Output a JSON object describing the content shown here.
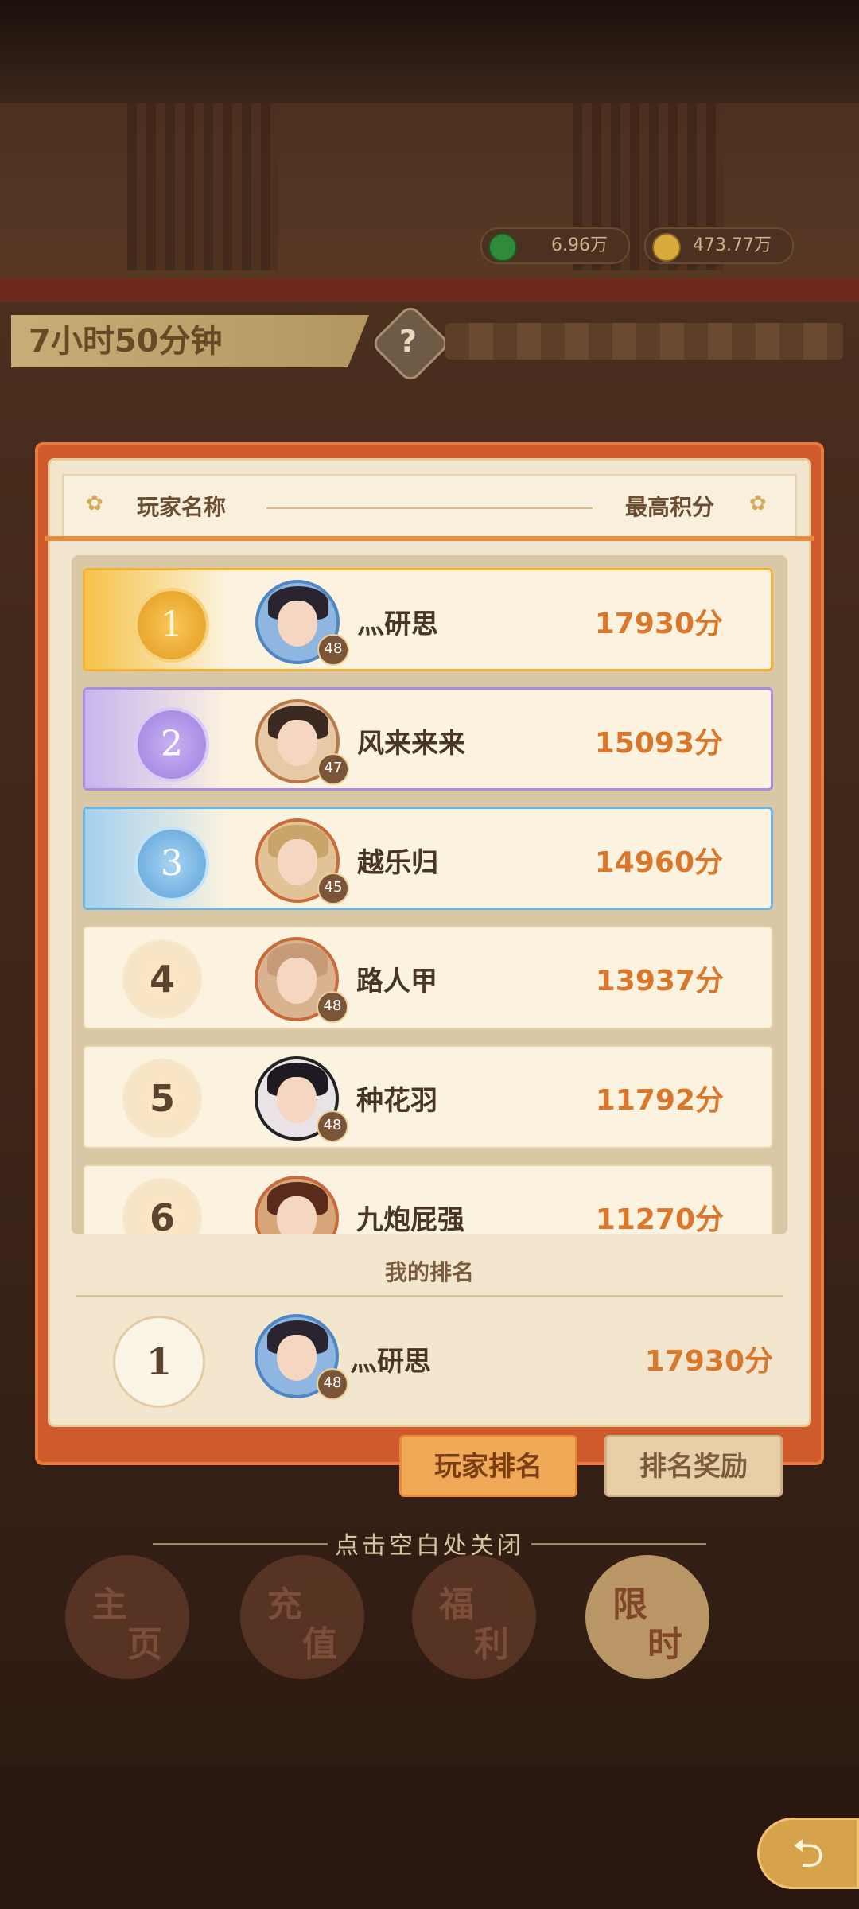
{
  "currency": {
    "jade": "6.96万",
    "coins": "473.77万"
  },
  "timer": {
    "text": "7小时50分钟",
    "help": "?"
  },
  "table_header": {
    "name_col": "玩家名称",
    "score_col": "最高积分"
  },
  "ranking": [
    {
      "rank": "1",
      "name": "灬研思",
      "level": "48",
      "score": "17930分"
    },
    {
      "rank": "2",
      "name": "风来来来",
      "level": "47",
      "score": "15093分"
    },
    {
      "rank": "3",
      "name": "越乐归",
      "level": "45",
      "score": "14960分"
    },
    {
      "rank": "4",
      "name": "路人甲",
      "level": "48",
      "score": "13937分"
    },
    {
      "rank": "5",
      "name": "种花羽",
      "level": "48",
      "score": "11792分"
    },
    {
      "rank": "6",
      "name": "九炮屁强",
      "level": "",
      "score": "11270分"
    }
  ],
  "my_rank": {
    "label": "我的排名",
    "rank": "1",
    "name": "灬研思",
    "level": "48",
    "score": "17930分"
  },
  "tabs": {
    "player_rank": "玩家排名",
    "rank_reward": "排名奖励"
  },
  "close_hint": "点击空白处关闭",
  "nav": {
    "home": [
      "主",
      "页"
    ],
    "recharge": [
      "充",
      "值"
    ],
    "welfare": [
      "福",
      "利"
    ],
    "limited": [
      "限",
      "时"
    ]
  },
  "colors": {
    "gold": "#f2b233",
    "purple": "#a98ee0",
    "blue": "#6fb2df",
    "score": "#d9782c",
    "dialog": "#cf5a2b"
  },
  "icons": {
    "jade": "jade-coin-icon",
    "coin": "gold-coin-icon",
    "back": "back-arrow-icon"
  }
}
